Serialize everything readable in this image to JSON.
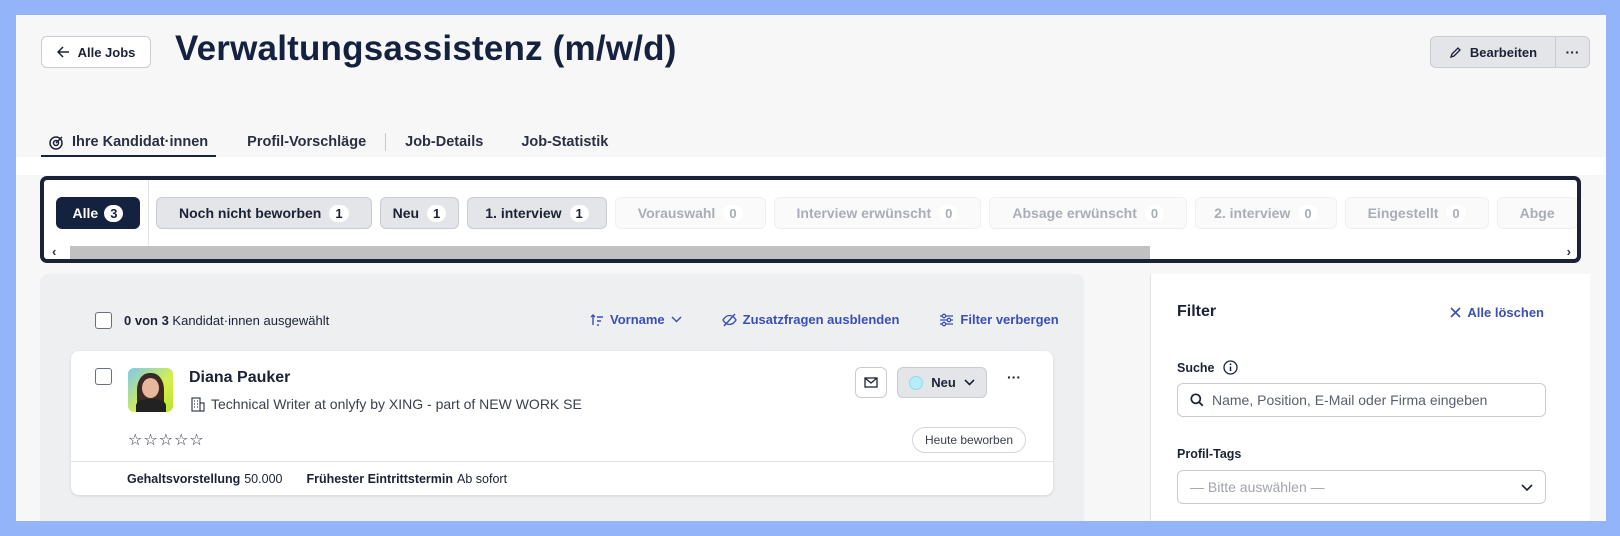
{
  "header": {
    "back_label": "Alle Jobs",
    "title": "Verwaltungsassistenz (m/w/d)",
    "edit_label": "Bearbeiten",
    "more_label": "···"
  },
  "tabs": [
    {
      "label": "Ihre Kandidat·innen",
      "icon": "target-icon",
      "active": true
    },
    {
      "label": "Profil-Vorschläge"
    },
    {
      "label": "Job-Details"
    },
    {
      "label": "Job-Statistik"
    }
  ],
  "status_filter": {
    "all": {
      "label": "Alle",
      "count": "3"
    },
    "chips": [
      {
        "label": "Noch nicht beworben",
        "count": "1",
        "active": true
      },
      {
        "label": "Neu",
        "count": "1",
        "active": true
      },
      {
        "label": "1. interview",
        "count": "1",
        "active": true
      },
      {
        "label": "Vorauswahl",
        "count": "0",
        "active": false
      },
      {
        "label": "Interview erwünscht",
        "count": "0",
        "active": false
      },
      {
        "label": "Absage erwünscht",
        "count": "0",
        "active": false
      },
      {
        "label": "2. interview",
        "count": "0",
        "active": false
      },
      {
        "label": "Eingestellt",
        "count": "0",
        "active": false
      },
      {
        "label": "Abge",
        "count": "",
        "active": false
      }
    ]
  },
  "candidates": {
    "selection": {
      "count": "0 von 3",
      "text": "Kandidat·innen ausgewählt"
    },
    "actions": {
      "sort_label": "Vorname",
      "hide_questions_label": "Zusatzfragen ausblenden",
      "hide_filter_label": "Filter verbergen"
    },
    "items": [
      {
        "name": "Diana Pauker",
        "position": "Technical Writer at onlyfy by XING - part of NEW WORK SE",
        "stars": "☆☆☆☆☆",
        "status": "Neu",
        "applied": "Heute beworben",
        "salary_label": "Gehaltsvorstellung",
        "salary_value": "50.000",
        "start_label": "Frühester Eintrittstermin",
        "start_value": "Ab sofort"
      }
    ]
  },
  "filter": {
    "title": "Filter",
    "clear_label": "Alle löschen",
    "search_label": "Suche",
    "search_placeholder": "Name, Position, E-Mail oder Firma eingeben",
    "tags_label": "Profil-Tags",
    "tags_placeholder": "— Bitte auswählen —"
  },
  "colors": {
    "primary": "#14223f",
    "accent": "#3a4fb8",
    "background": "#93b4f9"
  }
}
